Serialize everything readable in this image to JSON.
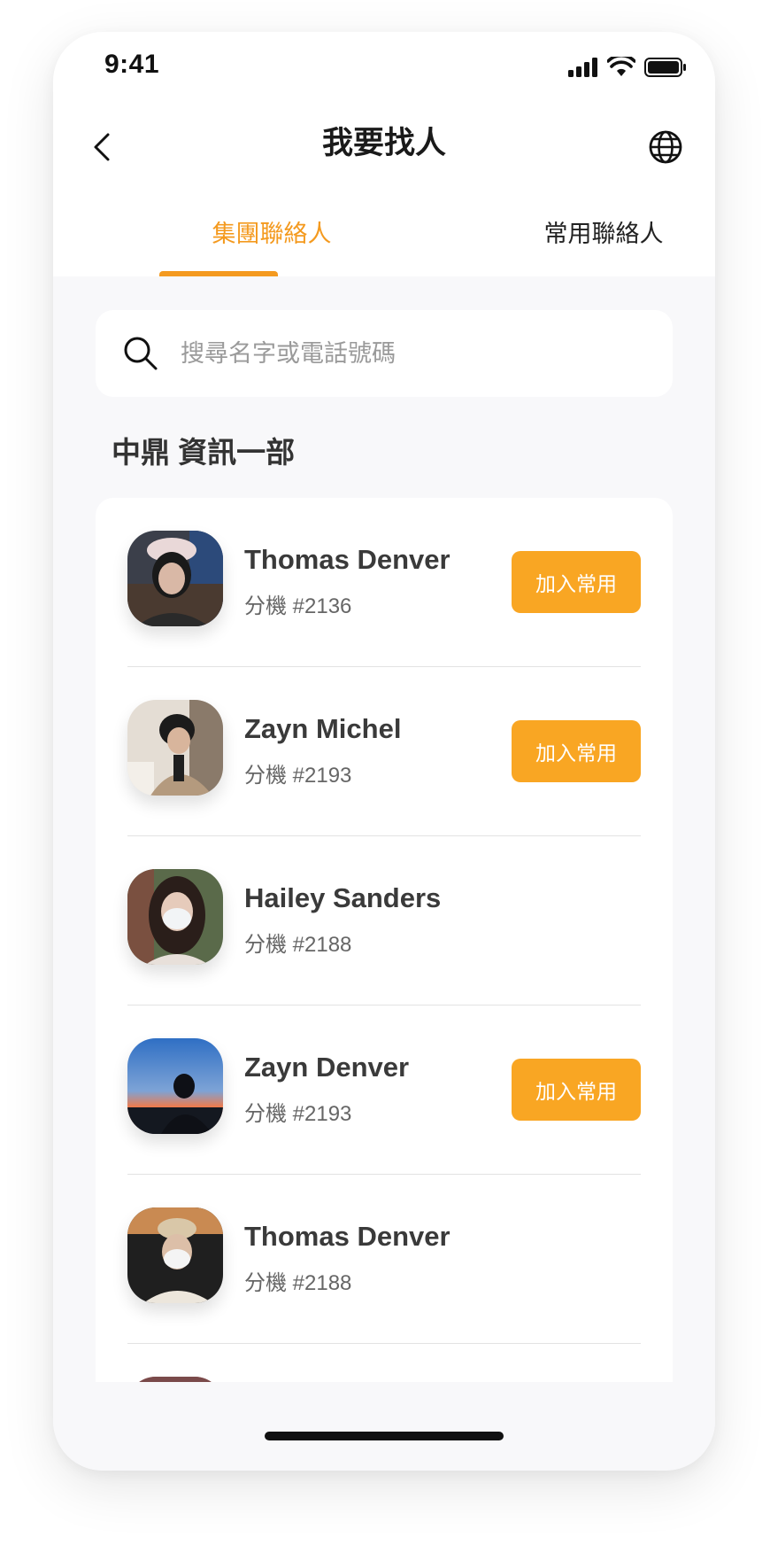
{
  "status_bar": {
    "time": "9:41"
  },
  "header": {
    "title": "我要找人",
    "back_icon": "chevron-left-icon",
    "language_icon": "globe-icon"
  },
  "tabs": [
    {
      "label": "集團聯絡人",
      "active": true
    },
    {
      "label": "常用聯絡人",
      "active": false
    }
  ],
  "search": {
    "placeholder": "搜尋名字或電話號碼",
    "value": ""
  },
  "section": {
    "title": "中鼎 資訊一部"
  },
  "contacts": [
    {
      "name": "Thomas Denver",
      "ext": "分機 #2136",
      "button": "加入常用",
      "has_button": true
    },
    {
      "name": "Zayn Michel",
      "ext": "分機 #2193",
      "button": "加入常用",
      "has_button": true
    },
    {
      "name": "Hailey Sanders",
      "ext": "分機 #2188",
      "button": "",
      "has_button": false
    },
    {
      "name": "Zayn Denver",
      "ext": "分機 #2193",
      "button": "加入常用",
      "has_button": true
    },
    {
      "name": "Thomas Denver",
      "ext": "分機 #2188",
      "button": "",
      "has_button": false
    }
  ],
  "colors": {
    "accent": "#f49a1f",
    "button": "#f9a623",
    "background": "#f8f8fa"
  }
}
